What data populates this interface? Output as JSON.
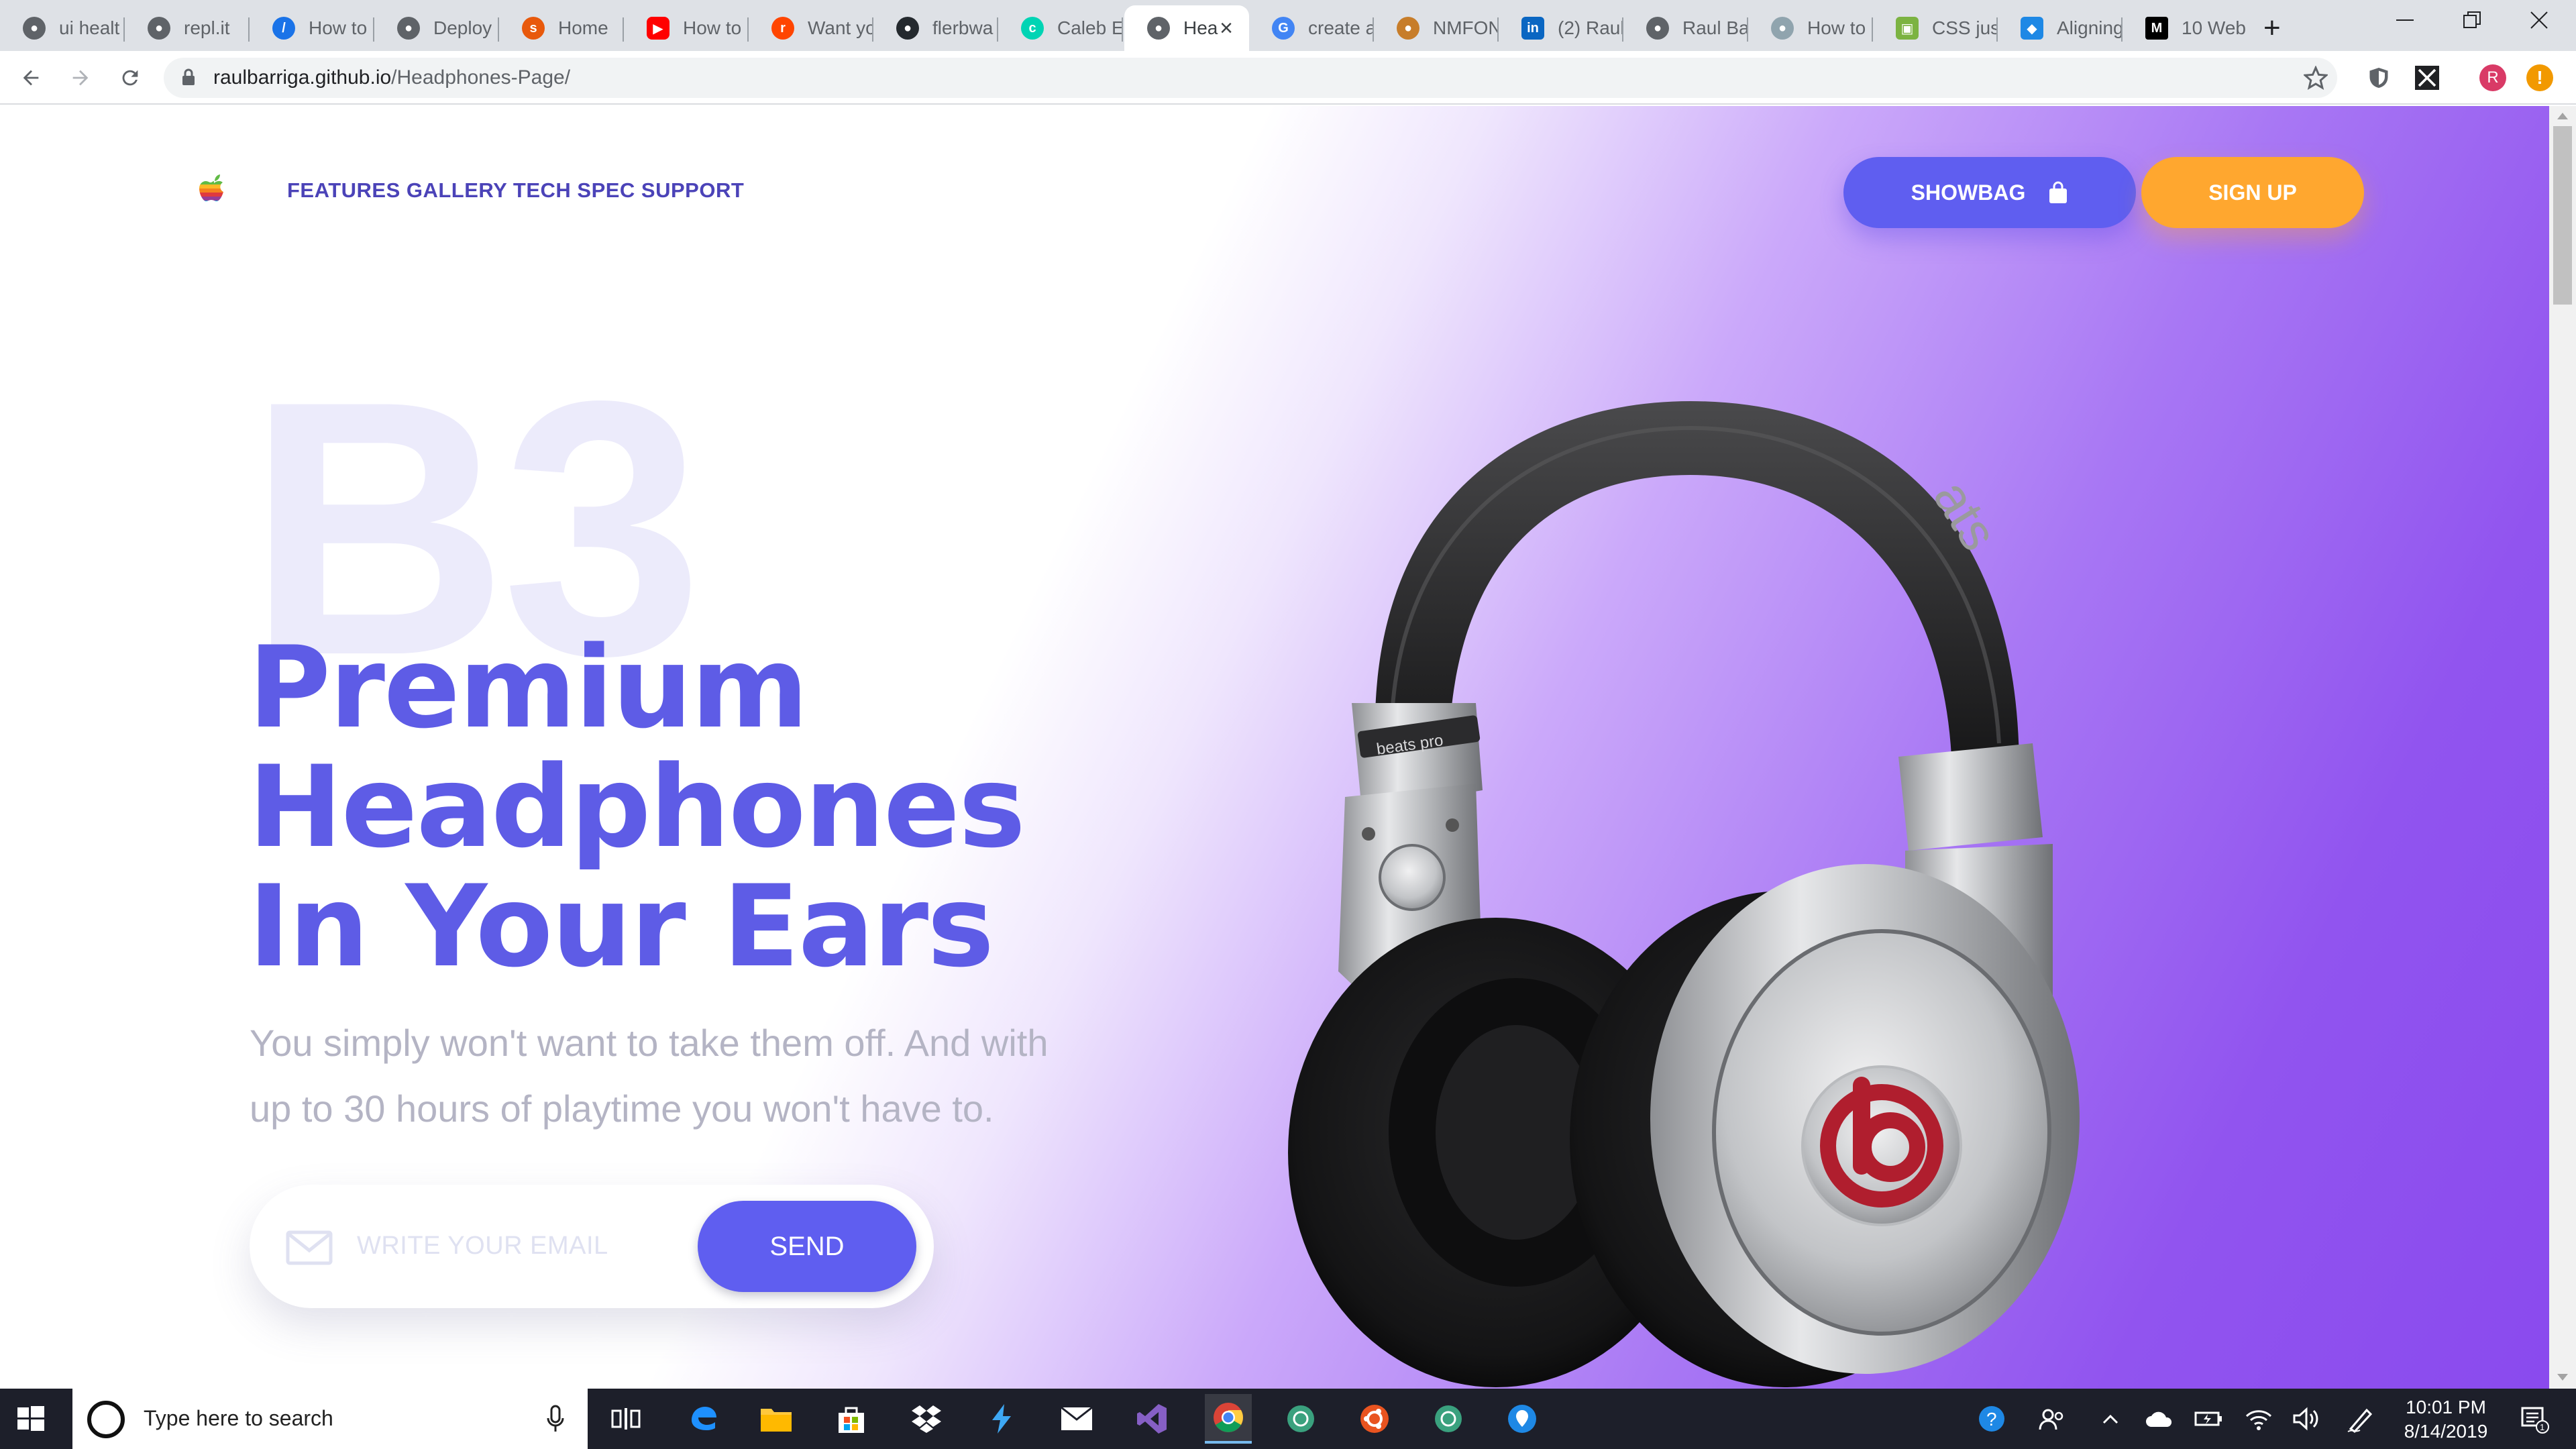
{
  "browser": {
    "tabs": [
      {
        "label": "ui healt",
        "color": "#5f6368"
      },
      {
        "label": "repl.it",
        "color": "#5f6368"
      },
      {
        "label": "How to",
        "color": "#1a73e8"
      },
      {
        "label": "Deploy",
        "color": "#5f6368"
      },
      {
        "label": "Home",
        "color": "#e8590c"
      },
      {
        "label": "How to",
        "color": "#ff0000"
      },
      {
        "label": "Want yo",
        "color": "#ff4500"
      },
      {
        "label": "flerbwa",
        "color": "#24292e"
      },
      {
        "label": "Caleb E",
        "color": "#00d4b4"
      },
      {
        "label": "Hea",
        "color": "#5f6368"
      },
      {
        "label": "create a",
        "color": "#4285f4"
      },
      {
        "label": "NMFON",
        "color": "#c77d2a"
      },
      {
        "label": "(2) Raul",
        "color": "#0a66c2"
      },
      {
        "label": "Raul Ba",
        "color": "#5f6368"
      },
      {
        "label": "How to",
        "color": "#90a4ae"
      },
      {
        "label": "CSS just",
        "color": "#7cb342"
      },
      {
        "label": "Aligning",
        "color": "#1e88e5"
      },
      {
        "label": "10 Web",
        "color": "#000000"
      }
    ],
    "new_tab_label": "+",
    "url_host": "raulbarriga.github.io",
    "url_path": "/Headphones-Page/",
    "profile_initial": "R"
  },
  "site": {
    "nav_links": "FEATURES GALLERY TECH SPEC SUPPORT",
    "showbag_label": "SHOWBAG",
    "signup_label": "SIGN UP",
    "hero_mark": "B3",
    "headline_line1": "Premium",
    "headline_line2": "Headphones",
    "headline_line3": "In Your Ears",
    "subtext": "You simply won't want to take them off. And with up to 30 hours of playtime you won't have to.",
    "email_placeholder": "WRITE YOUR EMAIL",
    "send_label": "SEND",
    "product_brand": "beats pro",
    "product_headband_text": "ats",
    "accent_purple": "#5f5ef0",
    "accent_orange": "#ffa72f"
  },
  "taskbar": {
    "search_placeholder": "Type here to search",
    "time": "10:01 PM",
    "date": "8/14/2019",
    "notification_count": "1"
  }
}
